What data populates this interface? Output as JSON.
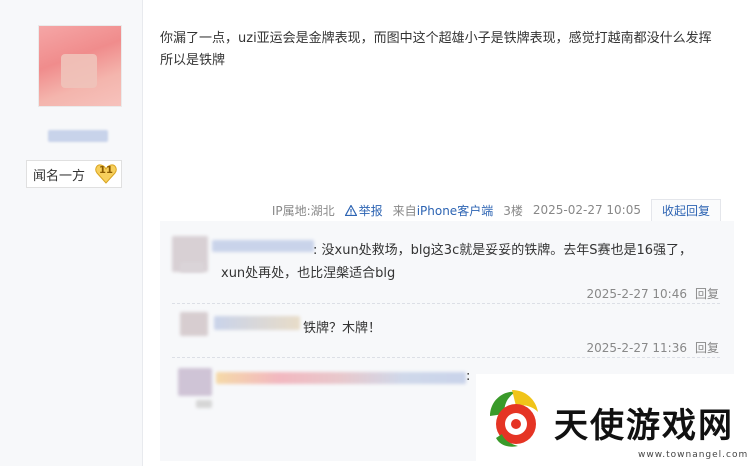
{
  "author": {
    "level_title": "闻名一方",
    "level_number": "11"
  },
  "post": {
    "content": "你漏了一点，uzi亚运会是金牌表现，而图中这个超雄小子是铁牌表现，感觉打越南都没什么发挥所以是铁牌",
    "ip": "IP属地:湖北",
    "report_label": "举报",
    "client_prefix": "来自",
    "client_name": "iPhone客户端",
    "floor": "3楼",
    "datetime": "2025-02-27 10:05",
    "fold_label": "收起回复"
  },
  "replies": [
    {
      "text_line1": ": 没xun处救场，blg这3c就是妥妥的铁牌。去年S赛也是16强了，",
      "text_line2": "xun处再处，也比涅槃适合blg",
      "time": "2025-2-27 10:46",
      "reply_label": "回复"
    },
    {
      "text_line1": "铁牌？木牌！",
      "time": "2025-2-27 11:36",
      "reply_label": "回复"
    },
    {
      "text_line1": ":"
    }
  ],
  "watermark": {
    "title": "天使游戏网",
    "url": "www.townangel.com"
  },
  "colors": {
    "link": "#2d64b3",
    "meta": "#888888",
    "text": "#333333",
    "reply_bg": "#f7f8fa"
  }
}
